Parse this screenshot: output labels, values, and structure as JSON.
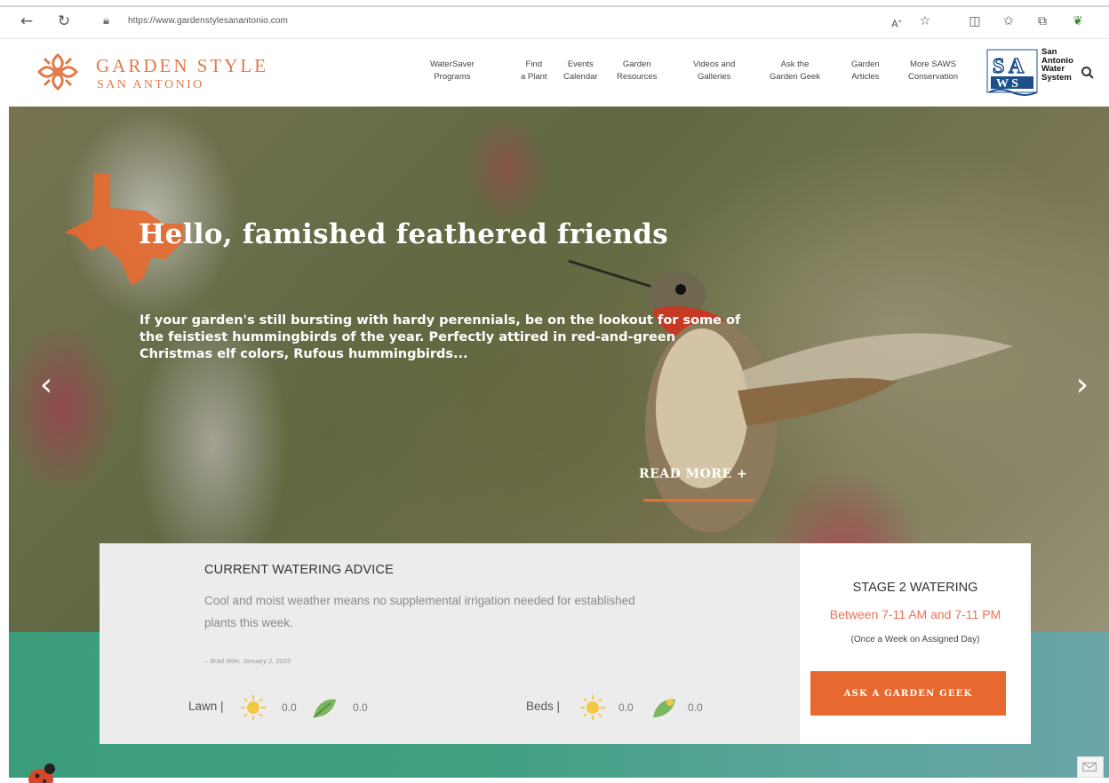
{
  "browser": {
    "url": "https://www.gardenstylesanantonio.com",
    "icons": [
      "back-arrow-icon",
      "refresh-icon",
      "lock-icon",
      "read-aloud-icon",
      "star-icon",
      "split-screen-icon",
      "favorites-icon",
      "collections-icon",
      "extension-icon"
    ]
  },
  "header": {
    "logo_title": "GARDEN STYLE",
    "logo_subtitle": "SAN ANTONIO",
    "nav": [
      {
        "line1": "WaterSaver",
        "line2": "Programs"
      },
      {
        "line1": "Find",
        "line2": "a Plant"
      },
      {
        "line1": "Events",
        "line2": "Calendar"
      },
      {
        "line1": "Garden",
        "line2": "Resources"
      },
      {
        "line1": "Videos and",
        "line2": "Galleries"
      },
      {
        "line1": "Ask the",
        "line2": "Garden Geek"
      },
      {
        "line1": "Garden",
        "line2": "Articles"
      },
      {
        "line1": "More SAWS",
        "line2": "Conservation"
      }
    ],
    "saws": {
      "line1": "San",
      "line2": "Antonio",
      "line3": "Water",
      "line4": "System"
    }
  },
  "hero": {
    "title": "Hello, famished feathered friends",
    "text": "If your garden's still bursting with hardy perennials, be on the lookout for some of the feistiest hummingbirds of the year. Perfectly attired in red-and-green Christmas elf colors, Rufous hummingbirds...",
    "read_more": "READ MORE +",
    "prev_arrow": "‹",
    "next_arrow": "›"
  },
  "advice": {
    "title": "CURRENT WATERING ADVICE",
    "text": "Cool and moist weather means no supplemental irrigation needed for established plants this week.",
    "credit": "– Brad Wier, January 2, 2023",
    "lawn": {
      "label": "Lawn",
      "sun_value": "0.0",
      "leaf_value": "0.0"
    },
    "beds": {
      "label": "Beds",
      "sun_value": "0.0",
      "leaf_value": "0.0"
    }
  },
  "stage": {
    "title": "STAGE 2 WATERING",
    "time": "Between 7-11 AM and 7-11 PM",
    "note": "(Once a Week on Assigned Day)",
    "button": "ASK A GARDEN GEEK"
  },
  "colors": {
    "brand_orange": "#e07a4a",
    "button_orange": "#e8692f",
    "band_green": "#3c9d7a",
    "time_red": "#e8735a"
  }
}
